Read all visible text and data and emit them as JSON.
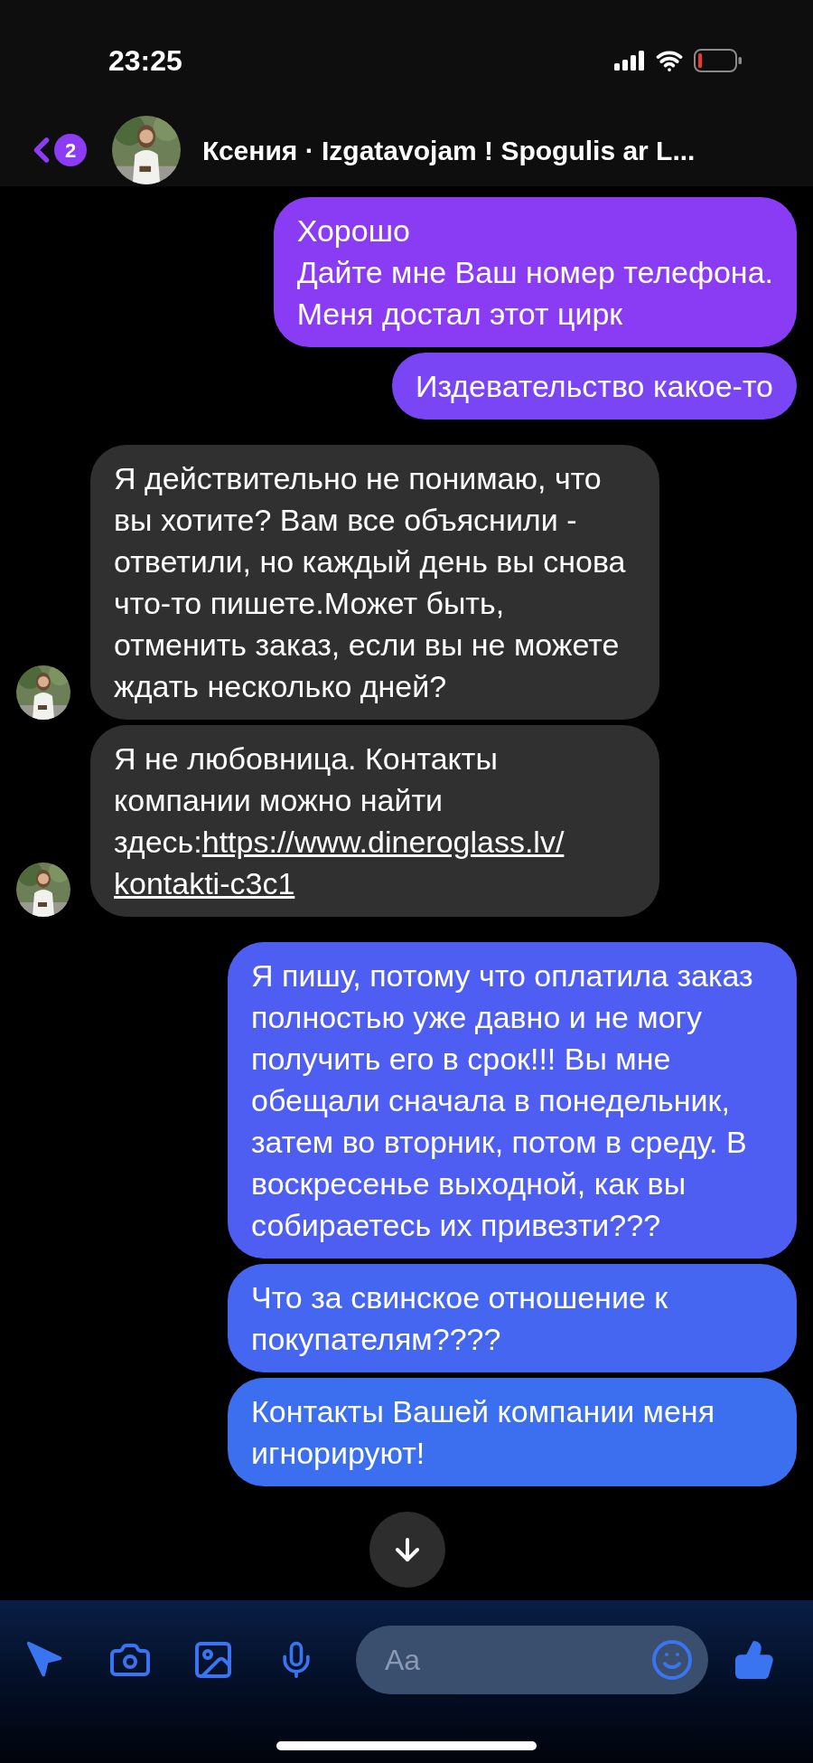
{
  "status_bar": {
    "time": "23:25"
  },
  "header": {
    "unread_count": "2",
    "title": "Ксения · Izgatavojam ! Spogulis ar L..."
  },
  "messages": [
    {
      "kind": "sent",
      "text": "Хорошо\nДайте мне Ваш номер телефона.\nМеня достал этот цирк"
    },
    {
      "kind": "sent",
      "text": "Издевательство какое-то"
    },
    {
      "kind": "received",
      "text": "Я действительно не понимаю, что вы хотите? Вам все объяснили - ответили, но каждый день вы снова что-то пишете.Может быть, отменить заказ, если вы не можете ждать несколько дней?"
    },
    {
      "kind": "received",
      "text": "Я не любовница. Контакты компании можно найти здесь:",
      "link_lines": [
        "https://www.dineroglass.lv/",
        "kontakti-c3c1"
      ]
    },
    {
      "kind": "sent",
      "text": "Я пишу, потому что оплатила заказ полностью уже давно и не могу получить его в срок!!! Вы мне обещали сначала в понедельник, затем во вторник, потом в среду. В воскресенье выходной, как вы собираетесь их привезти???"
    },
    {
      "kind": "sent",
      "text": "Что за свинское отношение к покупателям????"
    },
    {
      "kind": "sent",
      "text": "Контакты Вашей компании меня игнорируют!"
    }
  ],
  "composer": {
    "placeholder": "Aa"
  }
}
